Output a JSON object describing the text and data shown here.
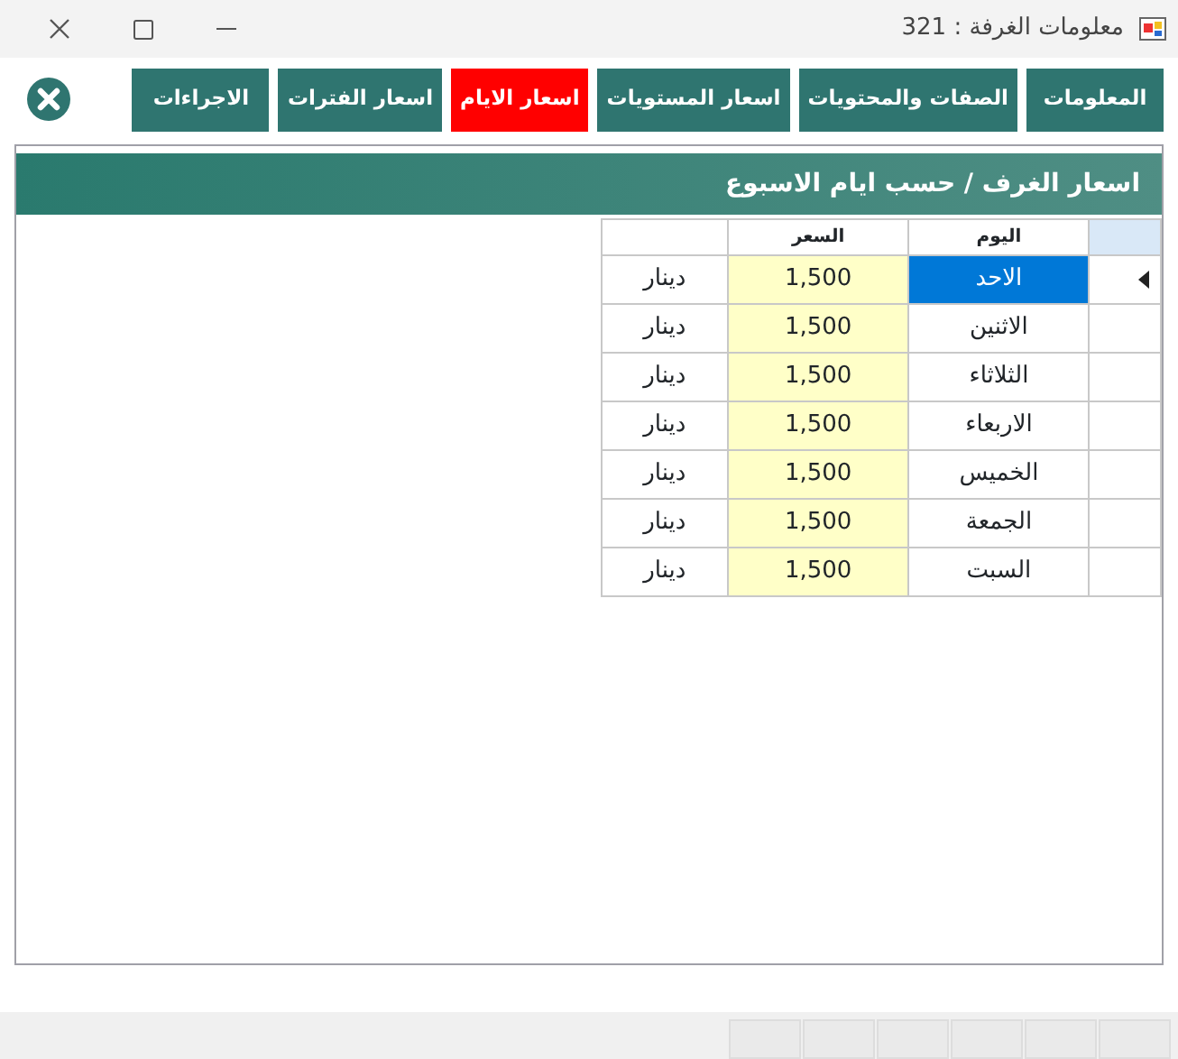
{
  "window": {
    "title": "معلومات الغرفة : 321"
  },
  "tabs": [
    {
      "label": "المعلومات",
      "selected": false
    },
    {
      "label": "الصفات والمحتويات",
      "selected": false
    },
    {
      "label": "اسعار المستويات",
      "selected": false
    },
    {
      "label": "اسعار الايام",
      "selected": true
    },
    {
      "label": "اسعار الفترات",
      "selected": false
    },
    {
      "label": "الاجراءات",
      "selected": false
    }
  ],
  "panel": {
    "title": "اسعار الغرف / حسب ايام الاسبوع"
  },
  "table": {
    "columns": [
      "اليوم",
      "السعر"
    ],
    "rows": [
      {
        "day": "الاحد",
        "price": "1,500",
        "currency": "دينار",
        "selected": true
      },
      {
        "day": "الاثنين",
        "price": "1,500",
        "currency": "دينار",
        "selected": false
      },
      {
        "day": "الثلاثاء",
        "price": "1,500",
        "currency": "دينار",
        "selected": false
      },
      {
        "day": "الاربعاء",
        "price": "1,500",
        "currency": "دينار",
        "selected": false
      },
      {
        "day": "الخميس",
        "price": "1,500",
        "currency": "دينار",
        "selected": false
      },
      {
        "day": "الجمعة",
        "price": "1,500",
        "currency": "دينار",
        "selected": false
      },
      {
        "day": "السبت",
        "price": "1,500",
        "currency": "دينار",
        "selected": false
      }
    ]
  }
}
